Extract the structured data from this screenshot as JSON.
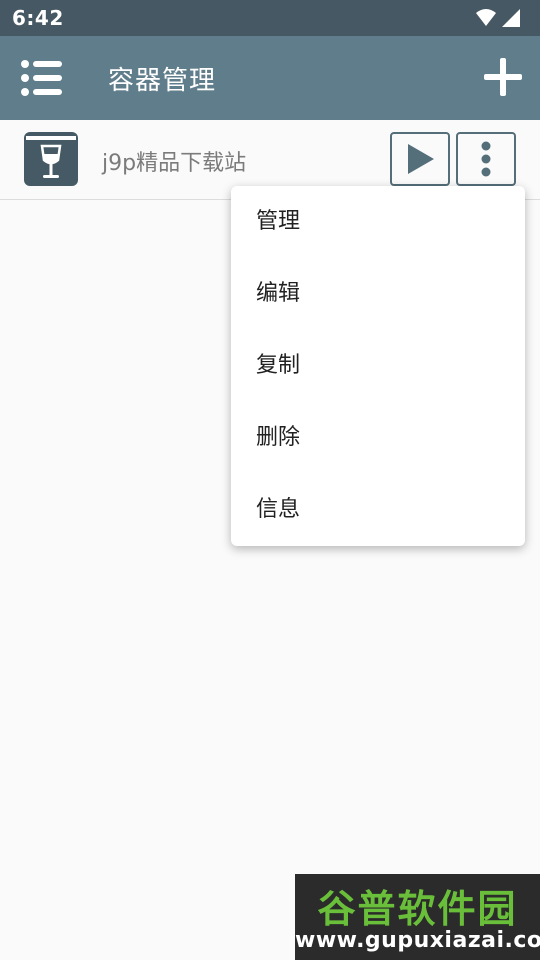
{
  "status_bar": {
    "time": "6:42",
    "icons": [
      "wifi-icon",
      "signal-icon"
    ]
  },
  "toolbar": {
    "title": "容器管理",
    "menu_icon": "list-menu-icon",
    "add_icon": "plus-icon"
  },
  "containers": [
    {
      "name": "j9p精品下载站",
      "icon": "wine-glass-box-icon"
    }
  ],
  "popup_menu": {
    "items": [
      {
        "label": "管理"
      },
      {
        "label": "编辑"
      },
      {
        "label": "复制"
      },
      {
        "label": "删除"
      },
      {
        "label": "信息"
      }
    ]
  },
  "watermark": {
    "title": "谷普软件园",
    "url": "www.gupuxiazai.com"
  },
  "colors": {
    "status_bar": "#465863",
    "toolbar": "#607d8b",
    "accent": "#546e7a",
    "background": "#fafafa"
  }
}
